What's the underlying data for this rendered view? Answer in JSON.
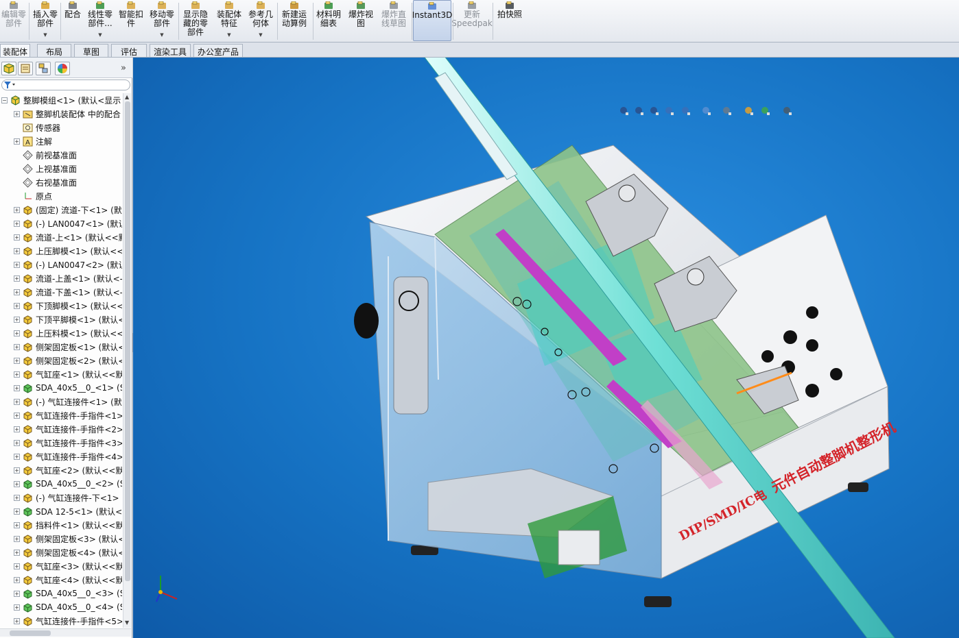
{
  "toolbar": {
    "buttons": [
      {
        "label": "编辑零\n部件",
        "icon": "edit-component-icon",
        "disabled": true,
        "dropdown": false
      },
      {
        "label": "插入零\n部件",
        "icon": "insert-component-icon",
        "disabled": false,
        "dropdown": true
      },
      {
        "label": "配合",
        "icon": "mate-icon",
        "disabled": false,
        "dropdown": false
      },
      {
        "label": "线性零\n部件...",
        "icon": "linear-pattern-icon",
        "disabled": false,
        "dropdown": true
      },
      {
        "label": "智能扣\n件",
        "icon": "smart-fastener-icon",
        "disabled": false,
        "dropdown": false
      },
      {
        "label": "移动零\n部件",
        "icon": "move-component-icon",
        "disabled": false,
        "dropdown": true
      },
      {
        "label": "显示隐\n藏的零\n部件",
        "icon": "show-hidden-icon",
        "disabled": false,
        "dropdown": false
      },
      {
        "label": "装配体\n特征",
        "icon": "assembly-feature-icon",
        "disabled": false,
        "dropdown": true
      },
      {
        "label": "参考几\n何体",
        "icon": "reference-geometry-icon",
        "disabled": false,
        "dropdown": true
      },
      {
        "label": "新建运\n动算例",
        "icon": "motion-study-icon",
        "disabled": false,
        "dropdown": false
      },
      {
        "label": "材料明\n细表",
        "icon": "bom-icon",
        "disabled": false,
        "dropdown": false
      },
      {
        "label": "爆炸视\n图",
        "icon": "exploded-view-icon",
        "disabled": false,
        "dropdown": false
      },
      {
        "label": "爆炸直\n线草图",
        "icon": "explode-line-icon",
        "disabled": true,
        "dropdown": false
      },
      {
        "label": "Instant3D",
        "icon": "instant3d-icon",
        "disabled": false,
        "dropdown": false,
        "active": true
      },
      {
        "label": "更新\nSpeedpak",
        "icon": "speedpak-icon",
        "disabled": true,
        "dropdown": false
      },
      {
        "label": "拍快照",
        "icon": "snapshot-icon",
        "disabled": false,
        "dropdown": false
      }
    ]
  },
  "command_tabs": [
    "装配体",
    "布局",
    "草图",
    "评估",
    "渲染工具",
    "办公室产品"
  ],
  "active_command_tab": "装配体",
  "feature_tree": {
    "root": "整脚模组<1> (默认<显示",
    "items": [
      {
        "label": "整脚机装配体 中的配合",
        "icon": "mates-folder-icon",
        "expand": "+"
      },
      {
        "label": "传感器",
        "icon": "sensor-icon",
        "expand": ""
      },
      {
        "label": "注解",
        "icon": "annotation-icon",
        "expand": "+"
      },
      {
        "label": "前视基准面",
        "icon": "plane-icon",
        "expand": ""
      },
      {
        "label": "上视基准面",
        "icon": "plane-icon",
        "expand": ""
      },
      {
        "label": "右视基准面",
        "icon": "plane-icon",
        "expand": ""
      },
      {
        "label": "原点",
        "icon": "origin-icon",
        "expand": ""
      },
      {
        "label": "(固定) 流道-下<1> (默",
        "icon": "part-icon",
        "expand": "+"
      },
      {
        "label": "(-) LAN0047<1> (默认",
        "icon": "part-icon",
        "expand": "+"
      },
      {
        "label": "流道-上<1> (默认<<默",
        "icon": "part-icon",
        "expand": "+"
      },
      {
        "label": "上压脚模<1> (默认<<",
        "icon": "part-icon",
        "expand": "+"
      },
      {
        "label": "(-) LAN0047<2> (默认",
        "icon": "part-icon",
        "expand": "+"
      },
      {
        "label": "流道-上盖<1> (默认<-",
        "icon": "part-icon",
        "expand": "+"
      },
      {
        "label": "流道-下盖<1> (默认<-",
        "icon": "part-icon",
        "expand": "+"
      },
      {
        "label": "下顶脚模<1> (默认<<",
        "icon": "part-icon",
        "expand": "+"
      },
      {
        "label": "下顶平脚模<1> (默认<",
        "icon": "part-icon",
        "expand": "+"
      },
      {
        "label": "上压料模<1> (默认<<",
        "icon": "part-icon",
        "expand": "+"
      },
      {
        "label": "侧架固定板<1> (默认<",
        "icon": "part-icon",
        "expand": "+"
      },
      {
        "label": "侧架固定板<2> (默认<",
        "icon": "part-icon",
        "expand": "+"
      },
      {
        "label": "气缸座<1> (默认<<默",
        "icon": "part-icon",
        "expand": "+"
      },
      {
        "label": "SDA_40x5__0_<1> (SD",
        "icon": "subassembly-icon",
        "expand": "+"
      },
      {
        "label": "(-) 气缸连接件<1> (默",
        "icon": "part-icon",
        "expand": "+"
      },
      {
        "label": "气缸连接件-手指件<1>",
        "icon": "part-icon",
        "expand": "+"
      },
      {
        "label": "气缸连接件-手指件<2>",
        "icon": "part-icon",
        "expand": "+"
      },
      {
        "label": "气缸连接件-手指件<3>",
        "icon": "part-icon",
        "expand": "+"
      },
      {
        "label": "气缸连接件-手指件<4>",
        "icon": "part-icon",
        "expand": "+"
      },
      {
        "label": "气缸座<2> (默认<<默",
        "icon": "part-icon",
        "expand": "+"
      },
      {
        "label": "SDA_40x5__0_<2> (SD",
        "icon": "subassembly-icon",
        "expand": "+"
      },
      {
        "label": "(-) 气缸连接件-下<1>",
        "icon": "part-icon",
        "expand": "+"
      },
      {
        "label": "SDA 12-5<1> (默认<",
        "icon": "subassembly-icon",
        "expand": "+"
      },
      {
        "label": "挡料件<1> (默认<<默",
        "icon": "part-icon",
        "expand": "+"
      },
      {
        "label": "侧架固定板<3> (默认<",
        "icon": "part-icon",
        "expand": "+"
      },
      {
        "label": "侧架固定板<4> (默认<",
        "icon": "part-icon",
        "expand": "+"
      },
      {
        "label": "气缸座<3> (默认<<默",
        "icon": "part-icon",
        "expand": "+"
      },
      {
        "label": "气缸座<4> (默认<<默",
        "icon": "part-icon",
        "expand": "+"
      },
      {
        "label": "SDA_40x5__0_<3> (SD",
        "icon": "subassembly-icon",
        "expand": "+"
      },
      {
        "label": "SDA_40x5__0_<4> (SD",
        "icon": "subassembly-icon",
        "expand": "+"
      },
      {
        "label": "气缸连接件-手指件<5>",
        "icon": "part-icon",
        "expand": "+"
      }
    ]
  },
  "model": {
    "machine_text": "DIP/SMD/IC电",
    "machine_text_2": "元件自动整脚机整形机",
    "colors": {
      "background": "#1673c4",
      "body": "#e8eaee",
      "panel": "#8ec48a",
      "rail": "#6fe0d6",
      "glass": "#9ec4e2",
      "magenta": "#c13fc7"
    }
  }
}
